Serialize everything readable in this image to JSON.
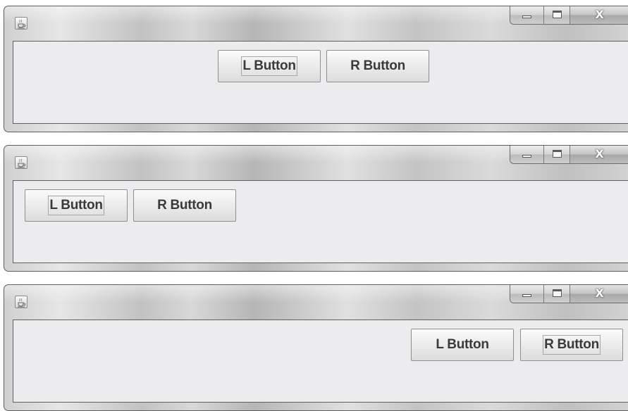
{
  "windows": [
    {
      "layout": "center",
      "buttons": [
        {
          "label": "L Button",
          "focused": true
        },
        {
          "label": "R Button",
          "focused": false
        }
      ]
    },
    {
      "layout": "left",
      "buttons": [
        {
          "label": "L Button",
          "focused": true
        },
        {
          "label": "R Button",
          "focused": false
        }
      ]
    },
    {
      "layout": "right",
      "buttons": [
        {
          "label": "L Button",
          "focused": false
        },
        {
          "label": "R Button",
          "focused": true
        }
      ]
    }
  ],
  "icons": {
    "window_icon": "java-cup-icon",
    "minimize": "minimize-icon",
    "maximize": "maximize-icon",
    "close": "close-icon"
  },
  "close_glyph": "X"
}
